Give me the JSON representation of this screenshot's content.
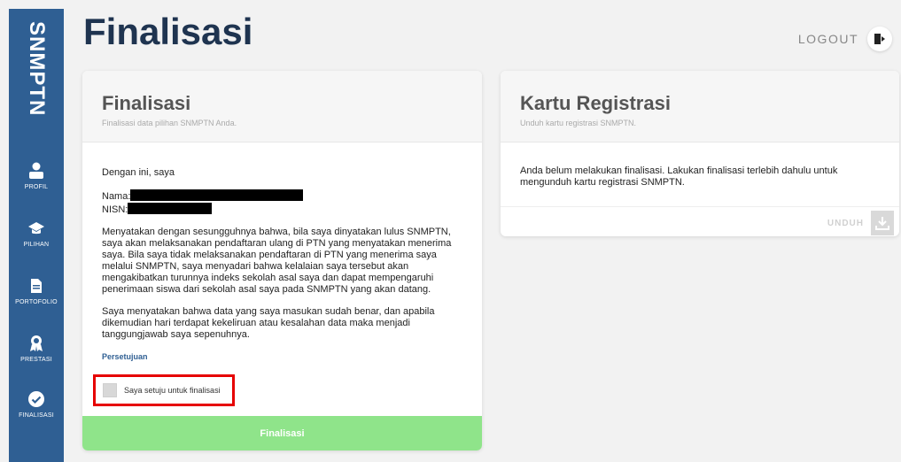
{
  "app": {
    "brand": "SNMPTN",
    "title": "Finalisasi",
    "logout_label": "LOGOUT"
  },
  "sidebar": {
    "items": [
      {
        "label": "PROFIL",
        "icon": "user-icon"
      },
      {
        "label": "PILIHAN",
        "icon": "graduation-cap-icon"
      },
      {
        "label": "PORTOFOLIO",
        "icon": "document-icon"
      },
      {
        "label": "PRESTASI",
        "icon": "award-icon"
      },
      {
        "label": "FINALISASI",
        "icon": "check-circle-icon"
      }
    ]
  },
  "finalisasi_card": {
    "title": "Finalisasi",
    "subtitle": "Finalisasi data pilihan SNMPTN Anda.",
    "intro": "Dengan ini, saya",
    "nama_label": "Nama:",
    "nisn_label": "NISN:",
    "paragraph1": "Menyatakan dengan sesungguhnya bahwa, bila saya dinyatakan lulus SNMPTN, saya akan melaksanakan pendaftaran ulang di PTN yang menyatakan menerima saya. Bila saya tidak melaksanakan pendaftaran di PTN yang menerima saya melalui SNMPTN, saya menyadari bahwa kelalaian saya tersebut akan mengakibatkan turunnya indeks sekolah asal saya dan dapat mempengaruhi penerimaan siswa dari sekolah asal saya pada SNMPTN yang akan datang.",
    "paragraph2": "Saya menyatakan bahwa data yang saya masukan sudah benar, dan apabila dikemudian hari terdapat kekeliruan atau kesalahan data maka menjadi tanggungjawab saya sepenuhnya.",
    "consent_label": "Persetujuan",
    "checkbox_label": "Saya setuju untuk finalisasi",
    "button_label": "Finalisasi"
  },
  "kartu_card": {
    "title": "Kartu Registrasi",
    "subtitle": "Unduh kartu registrasi SNMPTN.",
    "message": "Anda belum melakukan finalisasi. Lakukan finalisasi terlebih dahulu untuk mengunduh kartu registrasi SNMPTN.",
    "download_label": "UNDUH"
  },
  "colors": {
    "sidebar": "#2f5f93",
    "title": "#1f3450",
    "finalize_button": "#8fe48a",
    "highlight": "#e60000"
  }
}
